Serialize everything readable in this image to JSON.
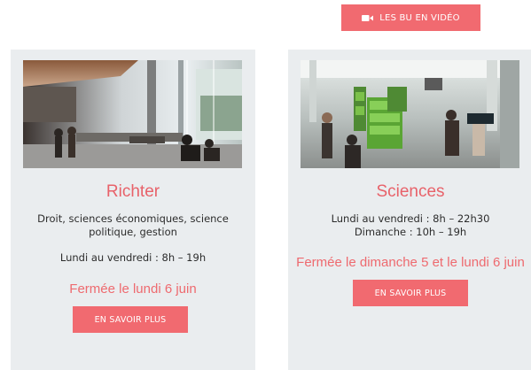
{
  "header": {
    "video_button_label": "LES BU EN VIDÉO",
    "video_icon": "video-camera-icon"
  },
  "libraries": [
    {
      "name": "Richter",
      "subjects": "Droit, sciences économiques, science politique, gestion",
      "hours": [
        "Lundi au vendredi : 8h – 19h"
      ],
      "closure": "Fermée le lundi 6 juin",
      "button_label": "EN SAVOIR PLUS"
    },
    {
      "name": "Sciences",
      "subjects": "",
      "hours": [
        "Lundi au vendredi : 8h – 22h30",
        "Dimanche : 10h – 19h"
      ],
      "closure": "Fermée le dimanche 5 et le lundi 6 juin",
      "button_label": "EN SAVOIR PLUS"
    }
  ],
  "colors": {
    "accent": "#f16a70",
    "title": "#e8626a",
    "card_background": "#eaedef"
  }
}
